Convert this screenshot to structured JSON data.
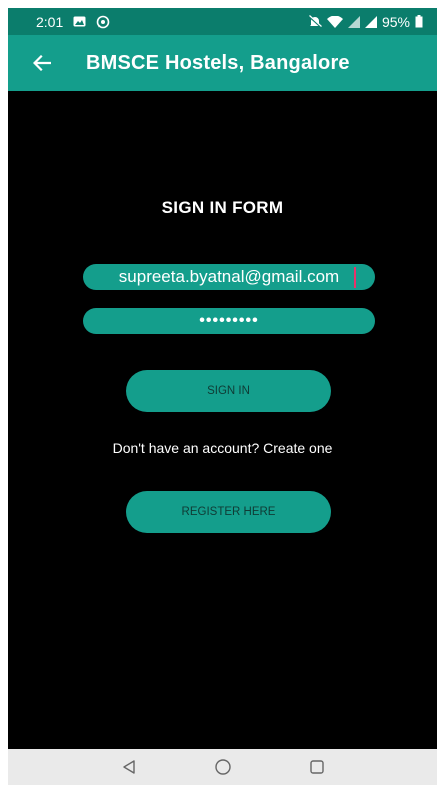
{
  "status_bar": {
    "time": "2:01",
    "battery": "95%",
    "icons": [
      "image-icon",
      "whatsapp-icon",
      "mute-icon",
      "wifi-icon",
      "signal-icon",
      "battery-icon"
    ]
  },
  "app_bar": {
    "title": "BMSCE Hostels, Bangalore",
    "back_icon": "arrow-left-icon"
  },
  "form": {
    "title": "SIGN IN FORM",
    "email_value": "supreeta.byatnal@gmail.com",
    "password_value": "•••••••••",
    "signin_label": "SIGN IN",
    "create_text": "Don't have an account? Create one",
    "register_label": "REGISTER HERE"
  },
  "nav": {
    "icons": [
      "back-triangle-icon",
      "home-circle-icon",
      "recents-square-icon"
    ]
  },
  "colors": {
    "status_bar": "#0b7d6c",
    "app_bar": "#149e8c",
    "accent": "#149e8c",
    "background": "#000000",
    "nav_bar": "#eaeaea",
    "caret": "#e8336a"
  }
}
